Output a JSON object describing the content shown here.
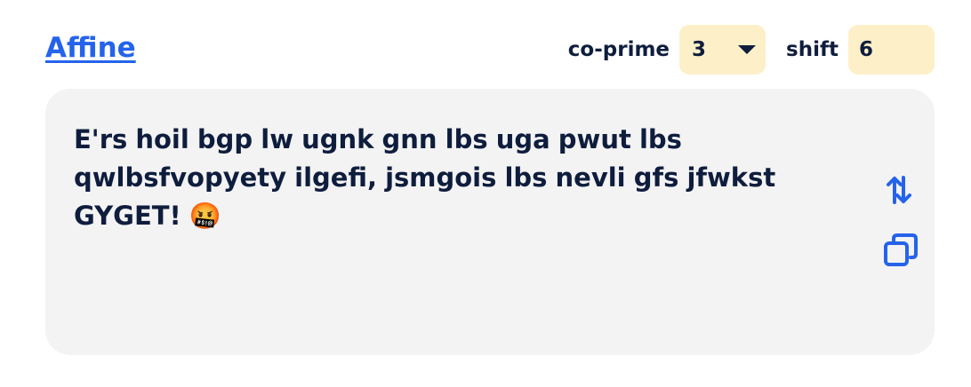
{
  "header": {
    "title": "Affine"
  },
  "controls": {
    "coprime_label": "co-prime",
    "coprime_value": "3",
    "shift_label": "shift",
    "shift_value": "6"
  },
  "output": {
    "text": "E'rs hoil bgp lw ugnk gnn lbs uga pwut lbs qwlbsfvopyety ilgefi, jsmgois lbs nevli gfs jfwkst GYGET! 🤬"
  },
  "icons": {
    "swap": "swap-arrows-icon",
    "copy": "copy-icon",
    "caret": "chevron-down-icon"
  },
  "colors": {
    "accent": "#2563eb",
    "text": "#0f1d3d",
    "field_bg": "#fdf0c8",
    "panel_bg": "#f3f3f4"
  }
}
